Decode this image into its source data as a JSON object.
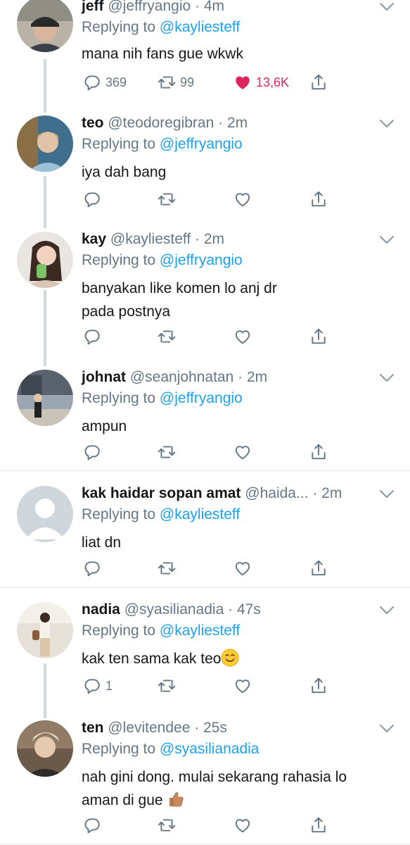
{
  "tweets": [
    {
      "name": "jeff",
      "handle": "@jeffryangio",
      "time": "4m",
      "reply_prefix": "Replying to",
      "reply_to": "@kayliesteff",
      "text": "mana nih fans gue wkwk",
      "replies": "369",
      "retweets": "99",
      "likes": "13,6K",
      "liked": true
    },
    {
      "name": "teo",
      "handle": "@teodoregibran",
      "time": "2m",
      "reply_prefix": "Replying to",
      "reply_to": "@jeffryangio",
      "text": "iya dah bang",
      "replies": "",
      "retweets": "",
      "likes": ""
    },
    {
      "name": "kay",
      "handle": "@kayliesteff",
      "time": "2m",
      "reply_prefix": "Replying to",
      "reply_to": "@jeffryangio",
      "text_line1": "banyakan like komen lo anj dr",
      "text_line2": "pada postnya",
      "replies": "",
      "retweets": "",
      "likes": ""
    },
    {
      "name": "johnat",
      "handle": "@seanjohnatan",
      "time": "2m",
      "reply_prefix": "Replying to",
      "reply_to": "@jeffryangio",
      "text": "ampun",
      "replies": "",
      "retweets": "",
      "likes": ""
    },
    {
      "name": "kak haidar sopan amat",
      "handle": "@haida...",
      "time": "2m",
      "reply_prefix": "Replying to",
      "reply_to": "@kayliesteff",
      "text": "liat dn",
      "replies": "",
      "retweets": "",
      "likes": ""
    },
    {
      "name": "nadia",
      "handle": "@syasilianadia",
      "time": "47s",
      "reply_prefix": "Replying to",
      "reply_to": "@kayliesteff",
      "text": "kak ten sama kak teo",
      "replies": "1",
      "retweets": "",
      "likes": ""
    },
    {
      "name": "ten",
      "handle": "@levitendee",
      "time": "25s",
      "reply_prefix": "Replying to",
      "reply_to": "@syasilianadia",
      "text_line1": "nah gini dong. mulai sekarang rahasia lo",
      "text_line2": "aman di gue",
      "replies": "",
      "retweets": "",
      "likes": ""
    }
  ],
  "colors": {
    "accent": "#1da1f2",
    "like": "#e0245e",
    "muted": "#657786",
    "thread": "#cfd9de"
  },
  "icons": [
    "reply-icon",
    "retweet-icon",
    "like-icon",
    "share-icon",
    "chevron-down-icon",
    "smile-emoji-icon",
    "thumbs-up-emoji-icon"
  ]
}
